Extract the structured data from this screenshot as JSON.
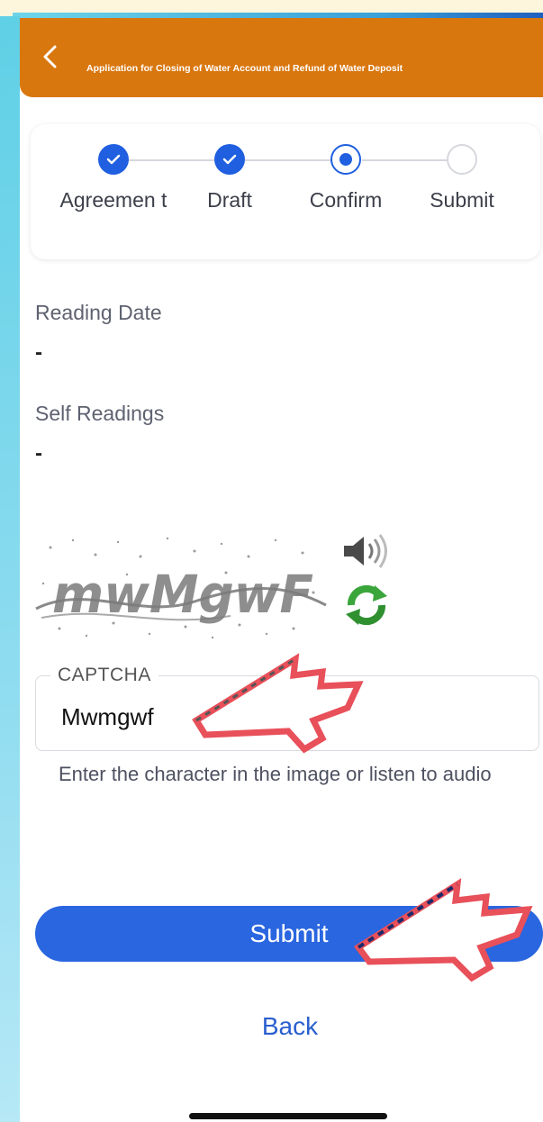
{
  "header": {
    "title": "Application for Closing of Water Account and Refund of Water Deposit",
    "accent_color": "#d9770f"
  },
  "stepper": {
    "steps": [
      {
        "label": "Agreemen t",
        "state": "done"
      },
      {
        "label": "Draft",
        "state": "done"
      },
      {
        "label": "Confirm",
        "state": "current"
      },
      {
        "label": "Submit",
        "state": "todo"
      }
    ],
    "active_color": "#1f5fe0"
  },
  "fields": {
    "reading_date_label": "Reading Date",
    "reading_date_value": "-",
    "self_readings_label": "Self Readings",
    "self_readings_value": "-"
  },
  "captcha": {
    "image_text": "mwMgwF",
    "label": "CAPTCHA",
    "value": "Mwmgwf",
    "helper": "Enter the character in the image or listen to audio"
  },
  "actions": {
    "submit_label": "Submit",
    "back_label": "Back",
    "primary_color": "#2a66e0"
  }
}
